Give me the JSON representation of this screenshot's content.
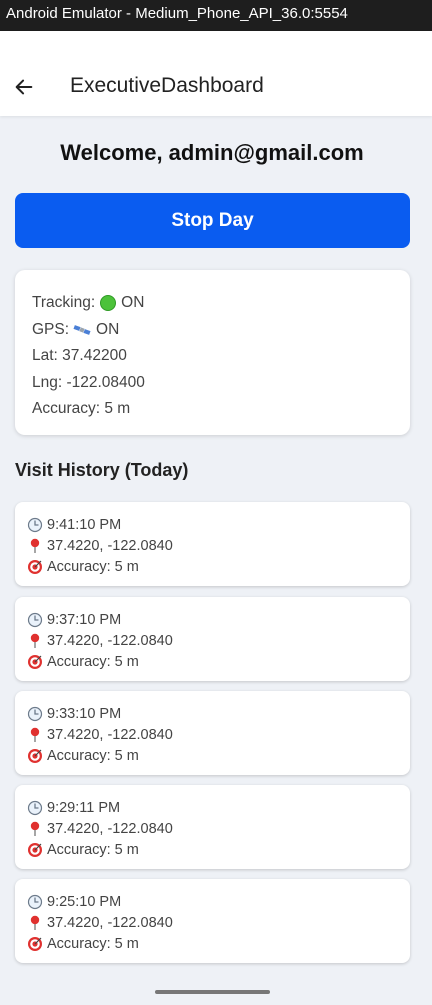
{
  "window": {
    "title": "Android Emulator - Medium_Phone_API_36.0:5554"
  },
  "appbar": {
    "title": "ExecutiveDashboard",
    "back_icon": "arrow-left-icon"
  },
  "welcome": "Welcome, admin@gmail.com",
  "stop_button": {
    "label": "Stop Day",
    "color": "#0a5cf0"
  },
  "status": {
    "tracking_label": "Tracking:",
    "tracking_value": "ON",
    "gps_label": "GPS:",
    "gps_value": "ON",
    "lat": "Lat: 37.42200",
    "lng": "Lng: -122.08400",
    "accuracy": "Accuracy: 5 m"
  },
  "history": {
    "title": "Visit History (Today)",
    "items": [
      {
        "time": "9:41:10 PM",
        "coords": "37.4220, -122.0840",
        "accuracy": "Accuracy: 5 m"
      },
      {
        "time": "9:37:10 PM",
        "coords": "37.4220, -122.0840",
        "accuracy": "Accuracy: 5 m"
      },
      {
        "time": "9:33:10 PM",
        "coords": "37.4220, -122.0840",
        "accuracy": "Accuracy: 5 m"
      },
      {
        "time": "9:29:11 PM",
        "coords": "37.4220, -122.0840",
        "accuracy": "Accuracy: 5 m"
      },
      {
        "time": "9:25:10 PM",
        "coords": "37.4220, -122.0840",
        "accuracy": "Accuracy: 5 m"
      }
    ]
  }
}
